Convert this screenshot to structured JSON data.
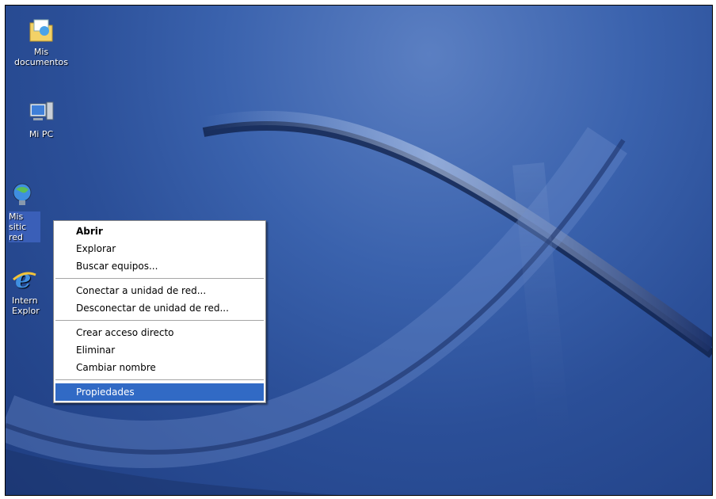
{
  "desktop": {
    "icons": [
      {
        "name": "mis-documentos",
        "label": "Mis documentos"
      },
      {
        "name": "mi-pc",
        "label": "Mi PC"
      },
      {
        "name": "mis-sitios-de-red",
        "label": "Mis sitic red"
      },
      {
        "name": "internet-explorer",
        "label": "Intern Explor"
      }
    ]
  },
  "context_menu": {
    "items": [
      "Abrir",
      "Explorar",
      "Buscar equipos...",
      "Conectar a unidad de red...",
      "Desconectar de unidad de red...",
      "Crear acceso directo",
      "Eliminar",
      "Cambiar nombre",
      "Propiedades"
    ]
  },
  "colors": {
    "menu_highlight": "#316ac5",
    "desktop": "#2b4f98"
  }
}
